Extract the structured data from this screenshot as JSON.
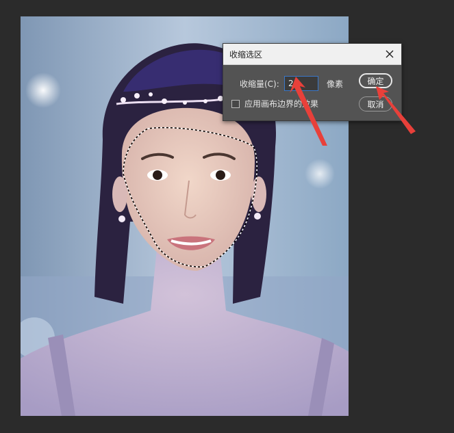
{
  "dialog": {
    "title": "收缩选区",
    "amount_label": "收缩量(C):",
    "amount_value": "20",
    "unit": "像素",
    "checkbox_label": "应用画布边界的效果",
    "checkbox_checked": false,
    "ok_label": "确定",
    "cancel_label": "取消"
  },
  "icons": {
    "close": "close-icon",
    "annotation_arrow": "red-arrow"
  },
  "colors": {
    "workspace_bg": "#2b2b2b",
    "dialog_bg": "#535353",
    "titlebar_bg": "#f0f0f0",
    "input_focus_border": "#3a78c9",
    "annotation_arrow": "#e8403a"
  }
}
